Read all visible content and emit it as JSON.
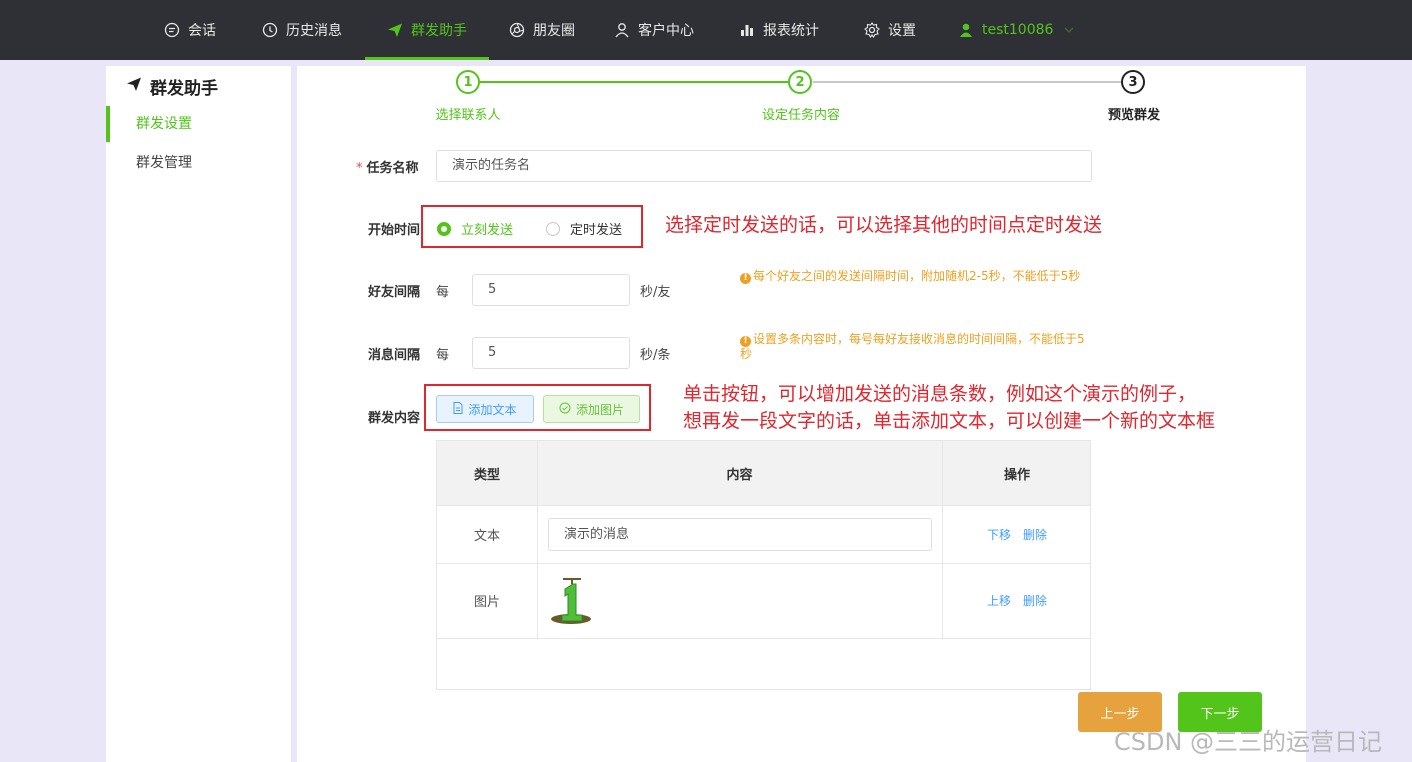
{
  "nav": {
    "items": [
      {
        "label": "会话",
        "icon": "chat-icon"
      },
      {
        "label": "历史消息",
        "icon": "clock-icon"
      },
      {
        "label": "群发助手",
        "icon": "send-icon",
        "active": true
      },
      {
        "label": "朋友圈",
        "icon": "aperture-icon"
      },
      {
        "label": "客户中心",
        "icon": "user-icon"
      },
      {
        "label": "报表统计",
        "icon": "bar-chart-icon"
      },
      {
        "label": "设置",
        "icon": "gear-icon"
      }
    ],
    "user": "test10086"
  },
  "sidebar": {
    "title": "群发助手",
    "items": [
      {
        "label": "群发设置",
        "active": true
      },
      {
        "label": "群发管理",
        "active": false
      }
    ]
  },
  "steps": [
    {
      "num": "1",
      "label": "选择联系人"
    },
    {
      "num": "2",
      "label": "设定任务内容"
    },
    {
      "num": "3",
      "label": "预览群发"
    }
  ],
  "form": {
    "task_name_label": "任务名称",
    "task_name_value": "演示的任务名",
    "start_time_label": "开始时间",
    "radio_now": "立刻发送",
    "radio_timed": "定时发送",
    "friend_interval_label": "好友间隔",
    "per": "每",
    "friend_interval_value": "5",
    "friend_interval_unit": "秒/友",
    "friend_tip": "每个好友之间的发送间隔时间，附加随机2-5秒，不能低于5秒",
    "msg_interval_label": "消息间隔",
    "msg_interval_value": "5",
    "msg_interval_unit": "秒/条",
    "msg_tip": "设置多条内容时，每号每好友接收消息的时间间隔，不能低于5秒",
    "content_label": "群发内容",
    "add_text": "添加文本",
    "add_image": "添加图片"
  },
  "annotations": {
    "timed": "选择定时发送的话，可以选择其他的时间点定时发送",
    "buttons_line1": "单击按钮，可以增加发送的消息条数，例如这个演示的例子，",
    "buttons_line2": "想再发一段文字的话，单击添加文本，可以创建一个新的文本框"
  },
  "table": {
    "headers": [
      "类型",
      "内容",
      "操作"
    ],
    "rows": [
      {
        "type": "文本",
        "content": "演示的消息",
        "actions": [
          "下移",
          "删除"
        ]
      },
      {
        "type": "图片",
        "content": "",
        "actions": [
          "上移",
          "删除"
        ]
      }
    ]
  },
  "buttons": {
    "prev": "上一步",
    "next": "下一步"
  },
  "watermark": "CSDN @三三的运营日记",
  "colors": {
    "accent": "#52c41a",
    "annotation": "#e0262f",
    "tip": "#f0a020",
    "link": "#409eff",
    "prev": "#e6a23c"
  }
}
